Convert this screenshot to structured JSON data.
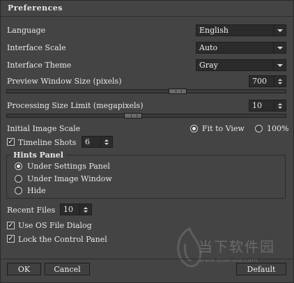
{
  "window": {
    "title": "Preferences"
  },
  "language": {
    "label": "Language",
    "value": "English"
  },
  "interface_scale": {
    "label": "Interface Scale",
    "value": "Auto"
  },
  "interface_theme": {
    "label": "Interface Theme",
    "value": "Gray"
  },
  "preview_size": {
    "label": "Preview Window Size (pixels)",
    "value": "700",
    "slider_fraction": 0.62
  },
  "processing_limit": {
    "label": "Processing Size Limit (megapixels)",
    "value": "10",
    "slider_fraction": 0.45
  },
  "initial_scale": {
    "label": "Initial Image Scale",
    "options": [
      "Fit to View",
      "100%"
    ],
    "selected": "Fit to View"
  },
  "timeline_shots": {
    "label": "Timeline Shots",
    "checked": true,
    "value": "6"
  },
  "hints_panel": {
    "title": "Hints Panel",
    "options": [
      "Under Settings Panel",
      "Under Image Window",
      "Hide"
    ],
    "selected": "Under Settings Panel"
  },
  "recent_files": {
    "label": "Recent Files",
    "value": "10"
  },
  "os_dialog": {
    "label": "Use OS File Dialog",
    "checked": true
  },
  "lock_panel": {
    "label": "Lock the Control Panel",
    "checked": true
  },
  "buttons": {
    "ok": "OK",
    "cancel": "Cancel",
    "default": "Default"
  },
  "watermark": {
    "text": "当下软件园",
    "url": "www.downxia.com"
  },
  "colors": {
    "background": "#444444",
    "field": "#2b2b2b",
    "text": "#e8e8e8"
  }
}
